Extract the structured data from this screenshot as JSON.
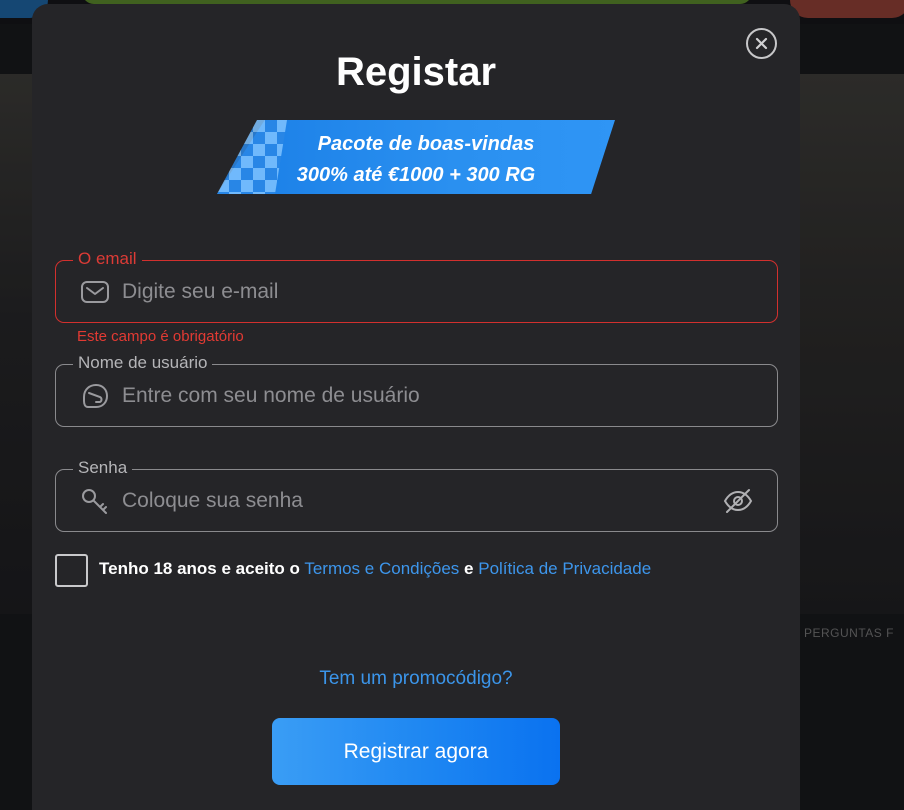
{
  "background": {
    "caption_right": "PERGUNTAS F"
  },
  "modal": {
    "title": "Registar",
    "promo_banner": {
      "line1": "Pacote de boas-vindas",
      "line2": "300% até €1000 + 300 RG"
    },
    "email": {
      "label": "O email",
      "placeholder": "Digite seu e-mail",
      "value": "",
      "error": "Este campo é obrigatório",
      "icon": "envelope-icon"
    },
    "username": {
      "label": "Nome de usuário",
      "placeholder": "Entre com seu nome de usuário",
      "value": "",
      "icon": "helmet-icon"
    },
    "password": {
      "label": "Senha",
      "placeholder": "Coloque sua senha",
      "value": "",
      "icon": "key-icon",
      "toggle_icon": "eye-off-icon"
    },
    "terms": {
      "checked": false,
      "prefix": "Tenho 18 anos e aceito o",
      "terms_link": "Termos e Condições",
      "connector": "e",
      "privacy_link": "Política de Privacidade"
    },
    "promo_code_link": "Tem um promocódigo?",
    "submit_label": "Registrar agora"
  },
  "colors": {
    "modal_bg": "#252528",
    "accent_blue": "#2a90f0",
    "error_red": "#d2302e",
    "link_blue": "#3d96ec"
  }
}
